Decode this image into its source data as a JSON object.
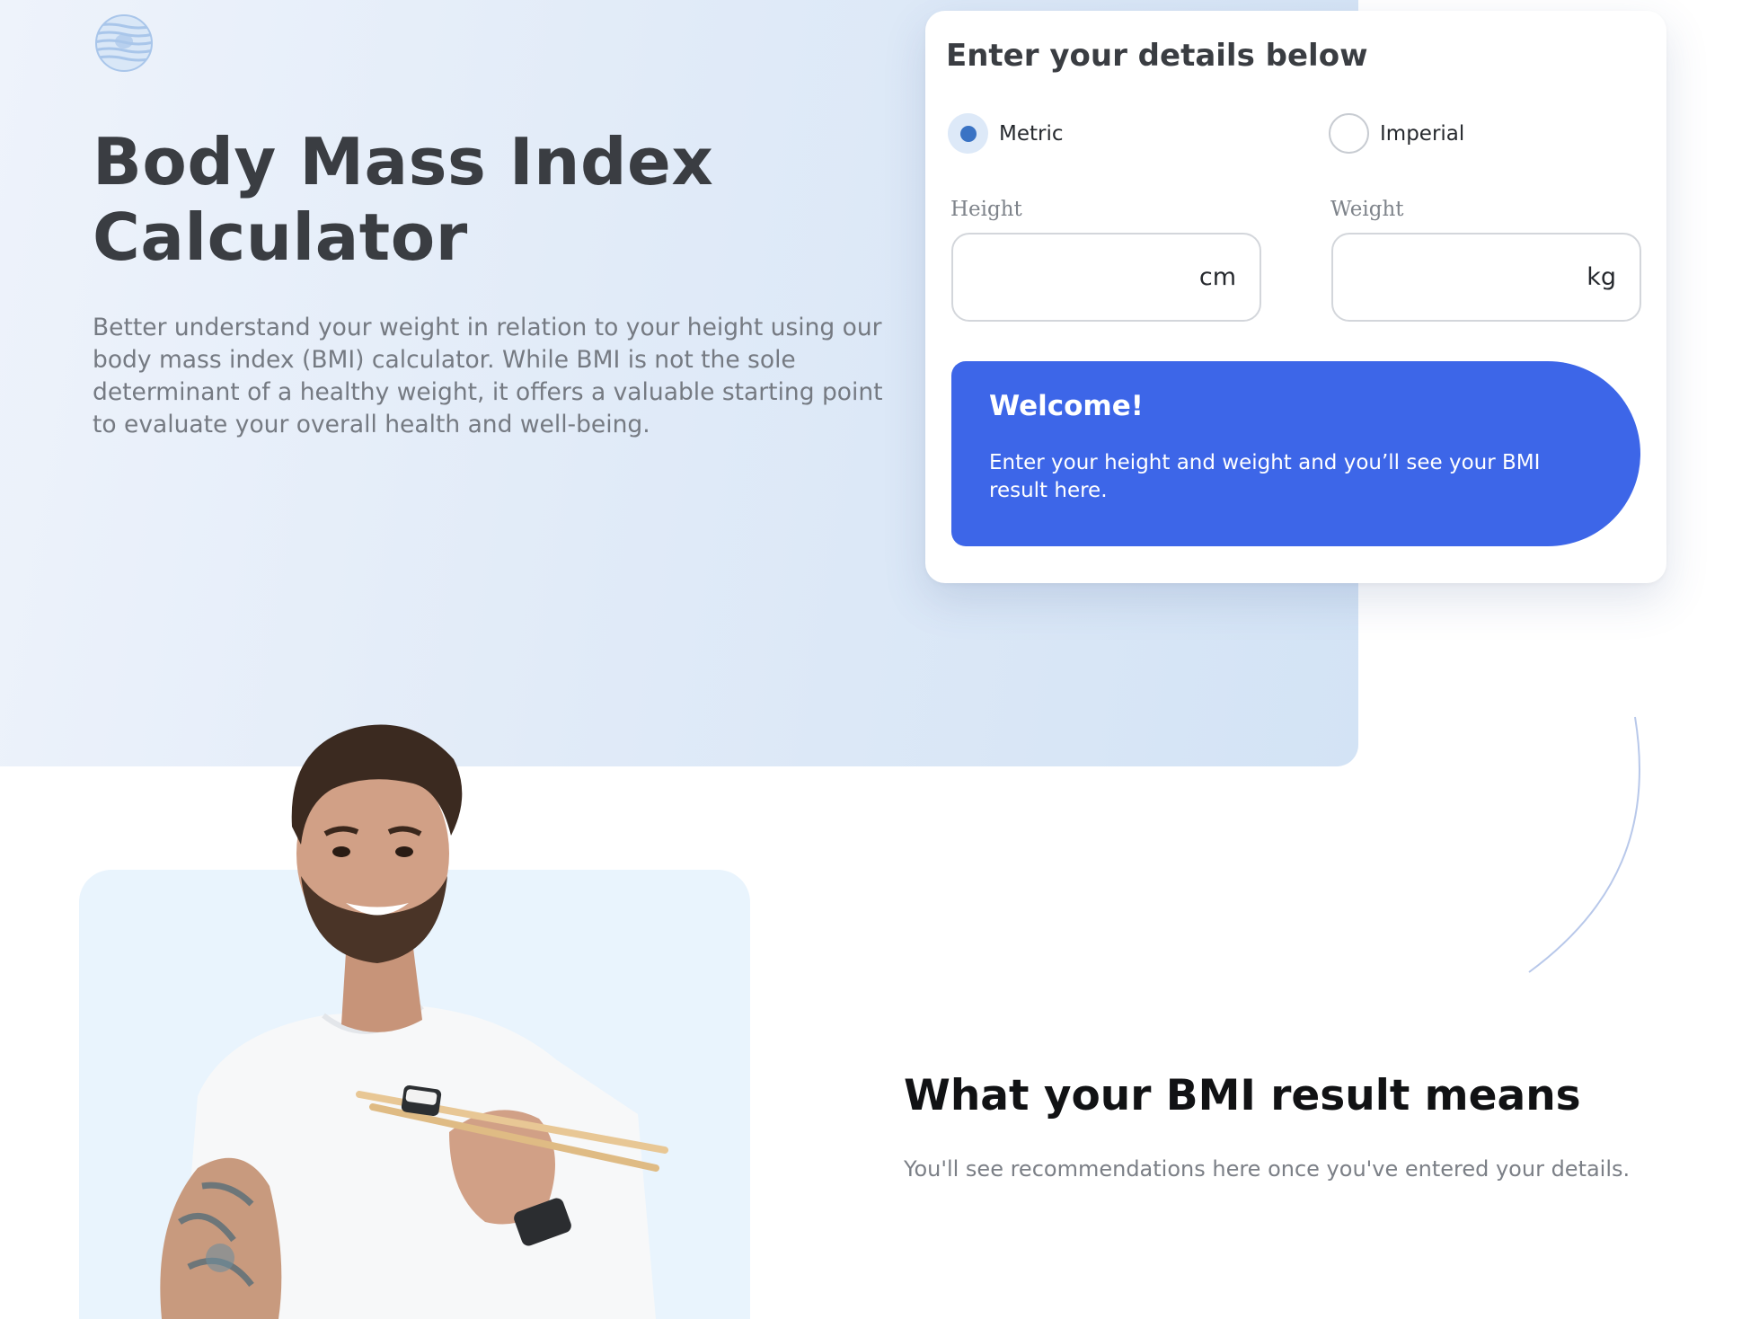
{
  "hero": {
    "title_line1": "Body Mass Index",
    "title_line2": "Calculator",
    "description": "Better understand your weight in relation to your height using our body mass index (BMI) calculator. While BMI is not the sole determinant of a healthy weight, it offers a valuable starting point to evaluate your overall health and well-being."
  },
  "form": {
    "title": "Enter your details below",
    "units": [
      {
        "label": "Metric",
        "selected": true
      },
      {
        "label": "Imperial",
        "selected": false
      }
    ],
    "height": {
      "label": "Height",
      "unit": "cm",
      "value": ""
    },
    "weight": {
      "label": "Weight",
      "unit": "kg",
      "value": ""
    }
  },
  "result": {
    "welcome_title": "Welcome!",
    "welcome_text": "Enter your height and weight and you’ll see your BMI result here."
  },
  "meaning": {
    "title": "What your BMI result means",
    "text": "You'll see recommendations here once you've entered your details."
  },
  "colors": {
    "accent_blue": "#3d66e8",
    "radio_fill": "#3a73c4",
    "heading_dark": "#3a3d42",
    "hero_bg": "#e1ebf8",
    "photo_panel_bg": "#e9f4fd"
  },
  "icons": {
    "logo": "striped-globe-logo-icon"
  }
}
